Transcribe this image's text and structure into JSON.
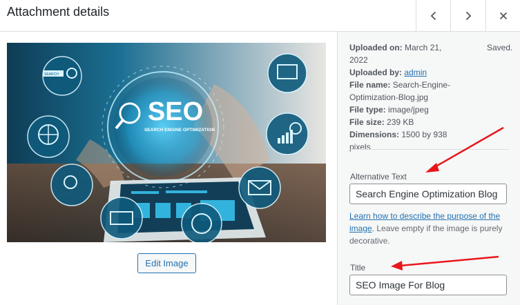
{
  "header": {
    "title": "Attachment details",
    "prev_label": "Previous",
    "next_label": "Next",
    "close_label": "Close"
  },
  "image": {
    "center_text": "SEO",
    "center_subtext": "SEARCH ENGINE OPTIMIZATION",
    "badge_text": "SEARCH"
  },
  "edit_button": "Edit Image",
  "details": {
    "uploaded_on_label": "Uploaded on:",
    "uploaded_on_value": "March 21, 2022",
    "uploaded_by_label": "Uploaded by:",
    "uploaded_by_value": "admin",
    "file_name_label": "File name:",
    "file_name_value": "Search-Engine-Optimization-Blog.jpg",
    "file_type_label": "File type:",
    "file_type_value": "image/jpeg",
    "file_size_label": "File size:",
    "file_size_value": "239 KB",
    "dimensions_label": "Dimensions:",
    "dimensions_value": "1500 by 938 pixels"
  },
  "saved_status": "Saved.",
  "alt_text": {
    "label": "Alternative Text",
    "value": "Search Engine Optimization Blog",
    "help_link": "Learn how to describe the purpose of the image",
    "help_text": ". Leave empty if the image is purely decorative."
  },
  "title_field": {
    "label": "Title",
    "value": "SEO Image For Blog"
  },
  "colors": {
    "accent": "#2271b1",
    "annotation_arrow": "#e8161b"
  }
}
